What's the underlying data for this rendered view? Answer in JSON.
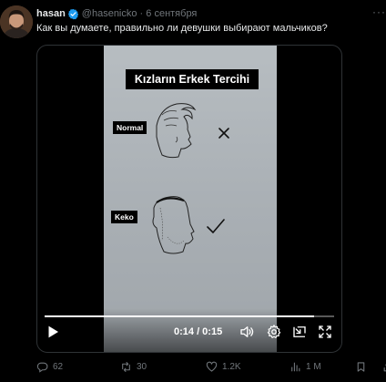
{
  "tweet": {
    "author": {
      "name": "hasan",
      "handle": "@hasenicko",
      "date": "6 сентября"
    },
    "text": "Как вы думаете, правильно ли девушки выбирают мальчиков?"
  },
  "video": {
    "overlay_title": "Kızların Erkek Tercihi",
    "tags": {
      "normal": "Normal",
      "keko": "Keko"
    },
    "current_time": "0:14",
    "duration": "0:15",
    "time_display": "0:14 / 0:15",
    "progress": 0.93
  },
  "actions": {
    "replies": "62",
    "retweets": "30",
    "likes": "1.2K",
    "views": "1 M"
  },
  "colors": {
    "verified_badge": "#1d9bf0",
    "muted_text": "#71767b",
    "border": "#2f3336"
  }
}
